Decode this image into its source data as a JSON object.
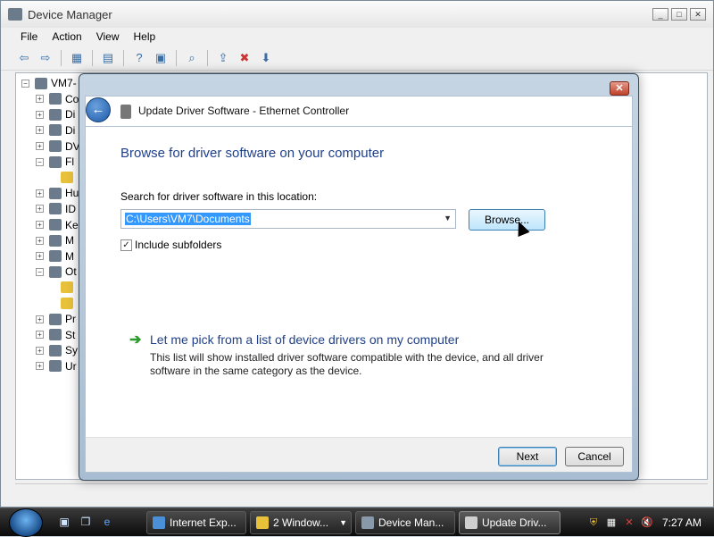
{
  "device_manager": {
    "title": "Device Manager",
    "controls": [
      "_",
      "□",
      "✕"
    ],
    "menu": [
      "File",
      "Action",
      "View",
      "Help"
    ],
    "tree_root": "VM7-",
    "tree_items": [
      "Co",
      "Di",
      "Di",
      "DV",
      "Fl",
      "",
      "Hu",
      "ID",
      "Ke",
      "M",
      "M",
      "Ot",
      "",
      "",
      "Pr",
      "St",
      "Sy",
      "Ur"
    ]
  },
  "dialog": {
    "title": "Update Driver Software - Ethernet Controller",
    "close": "✕",
    "heading": "Browse for driver software on your computer",
    "search_label": "Search for driver software in this location:",
    "path_value": "C:\\Users\\VM7\\Documents",
    "browse_label": "Browse...",
    "include_subfolders_label": "Include subfolders",
    "include_subfolders_checked": true,
    "pick_link": "Let me pick from a list of device drivers on my computer",
    "pick_description": "This list will show installed driver software compatible with the device, and all driver software in the same category as the device.",
    "next_label": "Next",
    "cancel_label": "Cancel"
  },
  "taskbar": {
    "tasks": [
      {
        "label": "Internet Exp...",
        "icon": "ie-icon"
      },
      {
        "label": "2 Window...",
        "icon": "folder-icon"
      },
      {
        "label": "Device Man...",
        "icon": "device-manager-icon"
      },
      {
        "label": "Update Driv...",
        "icon": "driver-icon"
      }
    ],
    "clock": "7:27 AM"
  },
  "colors": {
    "heading_blue": "#1e3f8a",
    "selection": "#3399ff",
    "link_arrow": "#2e9b2e"
  }
}
